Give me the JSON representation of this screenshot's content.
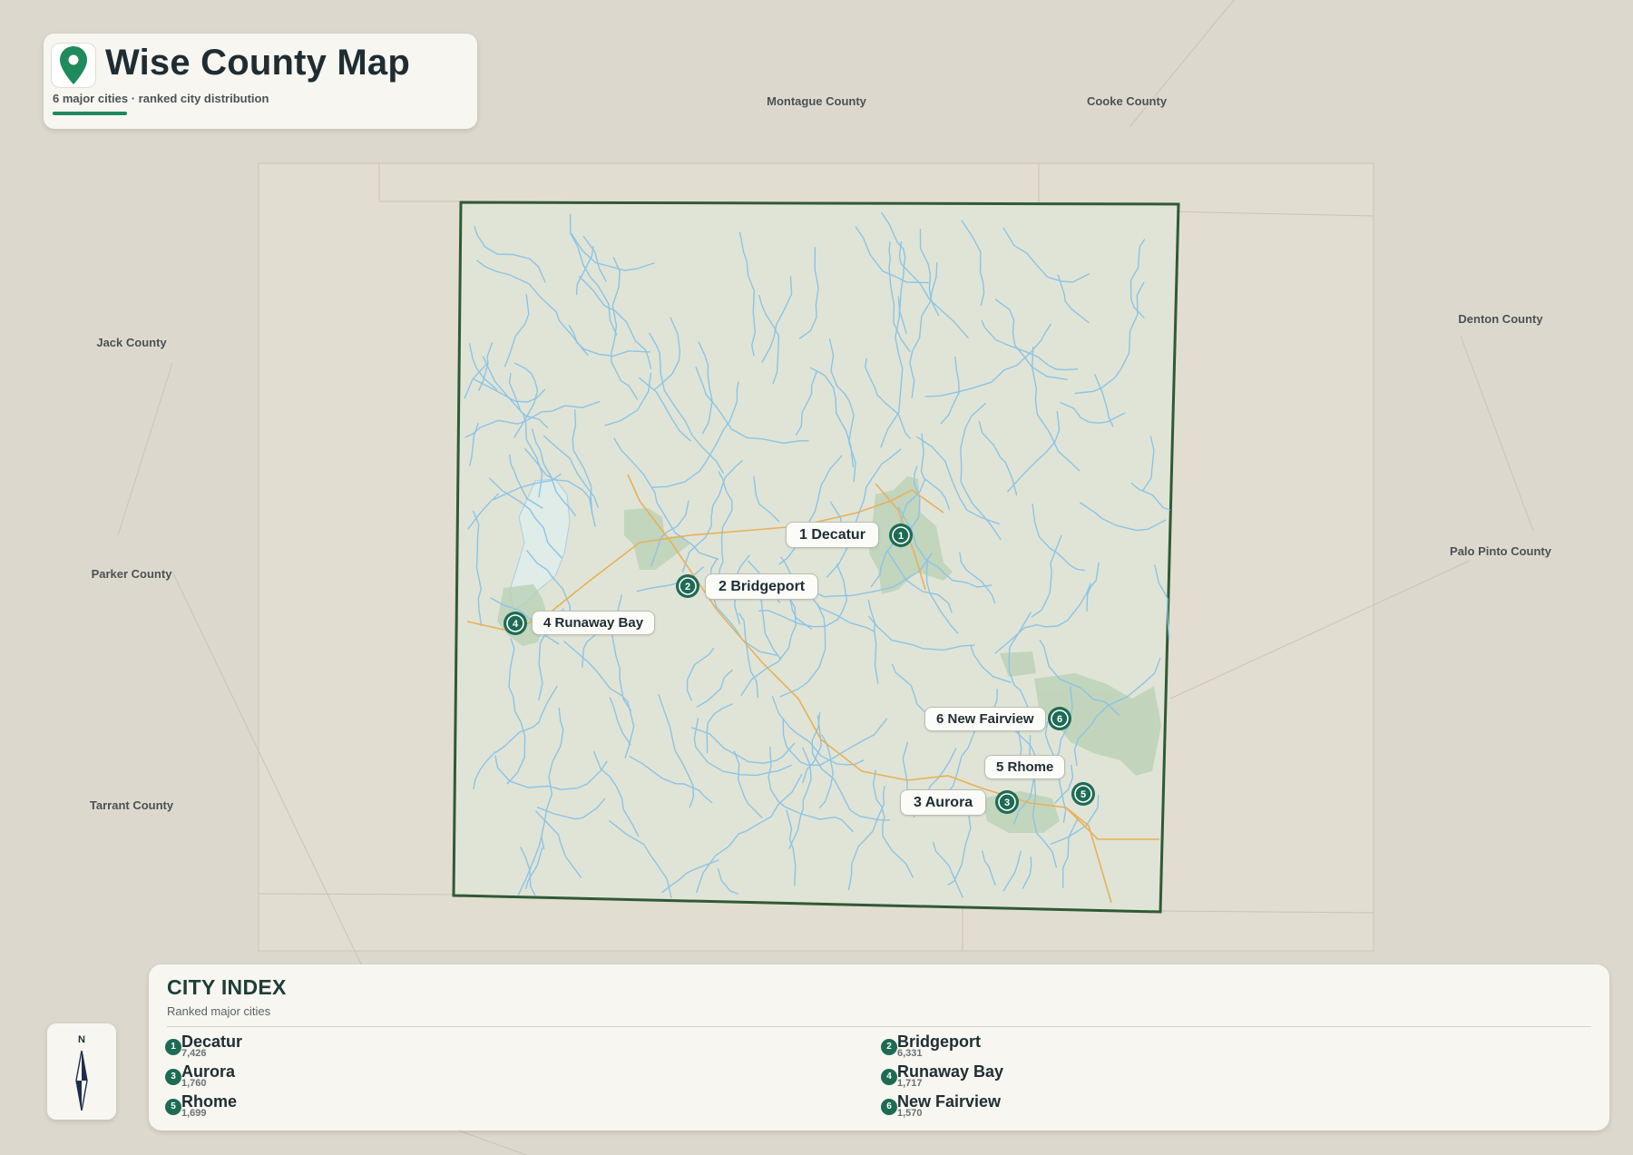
{
  "header": {
    "title": "Wise County Map",
    "subtitle": "6 major cities · ranked city distribution",
    "icon": "map-pin-icon"
  },
  "colors": {
    "accent": "#1f8a5b",
    "marker": "#1e6b54",
    "county_border": "#2f5a36",
    "county_fill": "#e0e4d6",
    "rivers": "#8cc4e6",
    "roads": "#e8b05a",
    "urban": "#b8d0b4",
    "lake": "#dfece8",
    "background": "#dcd8cd"
  },
  "neighbor_counties": [
    {
      "id": "montague",
      "label": "Montague County"
    },
    {
      "id": "cooke",
      "label": "Cooke County"
    },
    {
      "id": "jack",
      "label": "Jack County"
    },
    {
      "id": "denton",
      "label": "Denton County"
    },
    {
      "id": "parker",
      "label": "Parker County"
    },
    {
      "id": "palo-pinto",
      "label": "Palo Pinto County"
    },
    {
      "id": "tarrant",
      "label": "Tarrant County"
    }
  ],
  "cities": [
    {
      "rank": "1",
      "name": "Decatur",
      "label": "1 Decatur",
      "population": "7,426"
    },
    {
      "rank": "2",
      "name": "Bridgeport",
      "label": "2 Bridgeport",
      "population": "6,331"
    },
    {
      "rank": "3",
      "name": "Aurora",
      "label": "3 Aurora",
      "population": "1,760"
    },
    {
      "rank": "4",
      "name": "Runaway Bay",
      "label": "4 Runaway Bay",
      "population": "1,717"
    },
    {
      "rank": "5",
      "name": "Rhome",
      "label": "5 Rhome",
      "population": "1,699"
    },
    {
      "rank": "6",
      "name": "New Fairview",
      "label": "6 New Fairview",
      "population": "1,570"
    }
  ],
  "compass": {
    "north_label": "N",
    "icon": "compass-arrow-icon"
  },
  "city_index": {
    "title": "CITY INDEX",
    "subtitle": "Ranked major cities"
  }
}
